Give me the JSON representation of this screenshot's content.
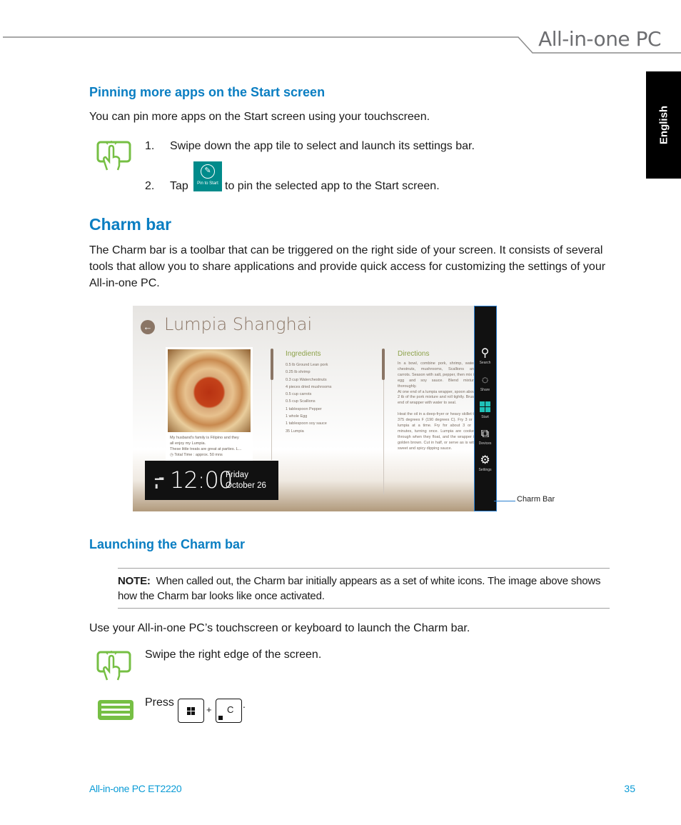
{
  "header": {
    "title": "All-in-one PC",
    "language_tab": "English"
  },
  "section_pinning": {
    "heading": "Pinning more apps on the Start screen",
    "intro": "You can pin more apps on the Start screen using your touchscreen.",
    "gesture_icon": "touch-swipe-icon",
    "steps": [
      {
        "num": "1.",
        "text": "Swipe down the app tile to select and launch its settings bar."
      },
      {
        "num": "2.",
        "text_before": "Tap",
        "text_after": "to pin the selected app to the Start screen."
      }
    ],
    "pin_tile": {
      "label": "Pin to Start",
      "icon": "pin-icon",
      "color": "#008B8B"
    }
  },
  "section_charm": {
    "heading": "Charm bar",
    "body": "The Charm bar is a toolbar that can be triggered on the right side of your screen. It consists of several tools that allow you to share applications and provide quick access for customizing the settings of your All-in-one PC."
  },
  "screenshot": {
    "app_title": "Lumpia Shanghai",
    "card_text": [
      "My husband's family is Filipino and they",
      "all enjoy my Lumpia.",
      "These little treats are great at parties. L...",
      "Total Time : approx. 50 mns"
    ],
    "ingredients_heading": "Ingredients",
    "ingredients": [
      "0.5 lb Ground Lean pork",
      "0.25 lb shrimp",
      "0.3 cup Waterchestnuts",
      "4 pieces dried mushrooms",
      "0.5 cup carrots",
      "0.5 cup Scallions",
      "1 tablespoon Pepper",
      "1 whole Egg",
      "1 tablespoon soy sauce",
      "35 Lumpia"
    ],
    "directions_heading": "Directions",
    "directions": "In a bowl, combine pork, shrimp, water-chestnuts, mushrooms, Scallions and carrots. Season with salt, pepper, then mix in egg and soy sauce. Blend mixture thoroughly.\nAt one end of a lumpia wrapper, spoon about 2 tb of the pork mixture and roll tightly. Brush end of wrapper with water to seal.\n\nHeat the oil in a deep-fryer or heavy skillet to 375 degrees F (190 degrees C). Fry 3 or 4 lumpia at a time. Fry for about 3 or 4 minutes, turning once. Lumpia are cooked through when they float, and the wrapper is golden brown. Cut in half, or serve as is with sweet and spicy dipping sauce.",
    "clock": {
      "time": "12:00",
      "day": "Friday",
      "date": "October 26"
    },
    "charms": [
      {
        "label": "Search",
        "icon": "search-icon"
      },
      {
        "label": "Share",
        "icon": "share-icon"
      },
      {
        "label": "Start",
        "icon": "windows-start-icon"
      },
      {
        "label": "Devices",
        "icon": "devices-icon"
      },
      {
        "label": "Settings",
        "icon": "settings-gear-icon"
      }
    ],
    "callout": "Charm Bar",
    "accent": "#1FC0B8"
  },
  "section_launch": {
    "heading": "Launching the Charm bar",
    "note_label": "NOTE:",
    "note_text": "When called out, the Charm bar initially appears as a set of white icons. The image above shows how the Charm bar looks like once activated.",
    "intro": "Use your All-in-one PC’s touchscreen or keyboard to launch the Charm bar.",
    "touch_text": "Swipe the right edge of the screen.",
    "keyboard_text": "Press",
    "keys": [
      "Windows",
      "C"
    ],
    "plus": "+",
    "period": "."
  },
  "footer": {
    "model": "All-in-one PC ET2220",
    "page": "35"
  },
  "colors": {
    "heading_blue": "#0A7EC2",
    "footer_blue": "#0A9BD6",
    "icon_green": "#76BF44"
  }
}
